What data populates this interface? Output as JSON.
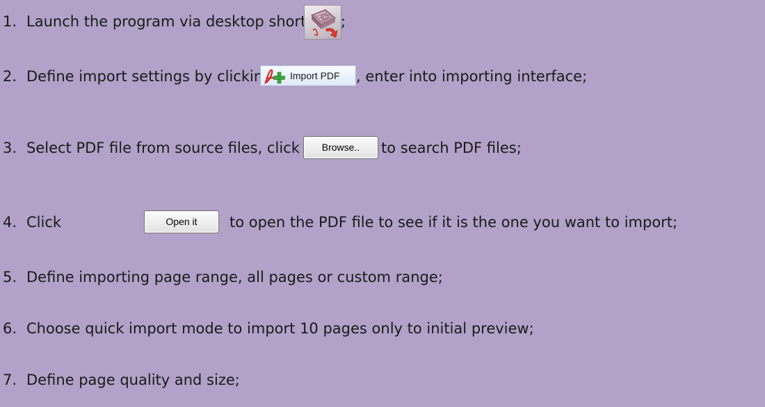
{
  "steps": [
    {
      "number": "1.",
      "text": "Launch the program via desktop shortcut",
      "suffix": ";"
    },
    {
      "number": "2.",
      "text_before": "Define import settings by clicking",
      "text_after": ", enter into importing interface;"
    },
    {
      "number": "3.",
      "text_before": "Select PDF file from source files, click",
      "text_after": "to search PDF files;"
    },
    {
      "number": "4.",
      "text_before": "Click",
      "text_after": "to open the PDF file to see if it is the one you want to import;"
    },
    {
      "number": "5.",
      "text": "Define importing page range, all pages or custom range;"
    },
    {
      "number": "6.",
      "text": "Choose quick import mode to import 10 pages only to initial preview;"
    },
    {
      "number": "7.",
      "text": "Define page quality and size;"
    }
  ],
  "buttons": {
    "import_pdf": "Import PDF",
    "browse": "Browse..",
    "open_it": "Open it"
  },
  "icons": {
    "app": "flipbook-app-icon",
    "pdf_add": "pdf-add-icon"
  },
  "colors": {
    "background": "#b2a1c8",
    "text": "#1a1a1a"
  }
}
